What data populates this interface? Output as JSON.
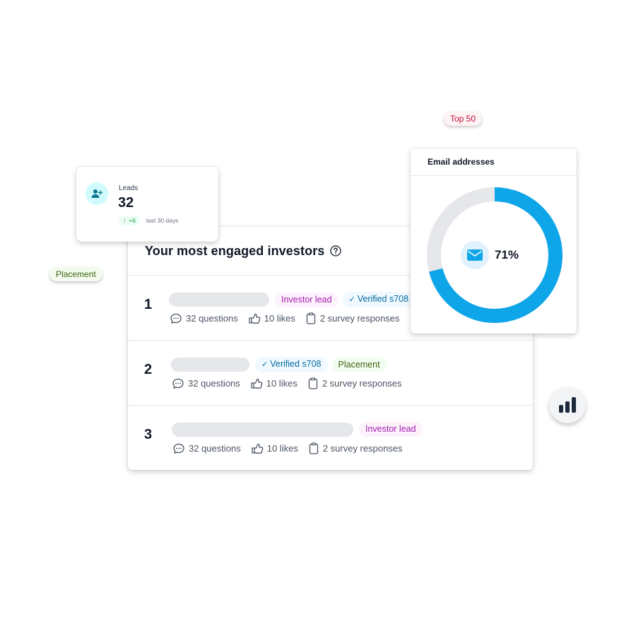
{
  "colors": {
    "accent": "#0ea5e9",
    "track": "#e5e7eb",
    "lead_tag": "#a21caf",
    "verified_tag": "#0369a1",
    "placement_tag": "#3f6212",
    "top50_tag": "#be123c",
    "positive": "#16a34a"
  },
  "floating_pills": {
    "top50": "Top 50",
    "placement": "Placement"
  },
  "leads_card": {
    "icon": "user-plus-icon",
    "label": "Leads",
    "value": "32",
    "delta": "+6",
    "delta_icon": "arrow-up-icon",
    "period": "last 30 days"
  },
  "email_card": {
    "title": "Email addresses",
    "icon": "envelope-icon",
    "percent_label": "71%",
    "percent_value": 0.71
  },
  "investors_card": {
    "title": "Your most engaged investors",
    "help_icon": "question-circle-icon",
    "rows": [
      {
        "rank": "1",
        "tags": [
          {
            "type": "lead",
            "label": "Investor lead"
          },
          {
            "type": "verified",
            "label": "Verified s708"
          }
        ],
        "questions": "32 questions",
        "likes": "10 likes",
        "surveys": "2 survey responses"
      },
      {
        "rank": "2",
        "tags": [
          {
            "type": "verified",
            "label": "Verified s708"
          },
          {
            "type": "placement",
            "label": "Placement"
          }
        ],
        "questions": "32 questions",
        "likes": "10 likes",
        "surveys": "2 survey responses"
      },
      {
        "rank": "3",
        "tags": [
          {
            "type": "lead",
            "label": "Investor lead"
          }
        ],
        "questions": "32 questions",
        "likes": "10 likes",
        "surveys": "2 survey responses"
      }
    ]
  },
  "fab": {
    "icon": "bar-chart-icon"
  }
}
